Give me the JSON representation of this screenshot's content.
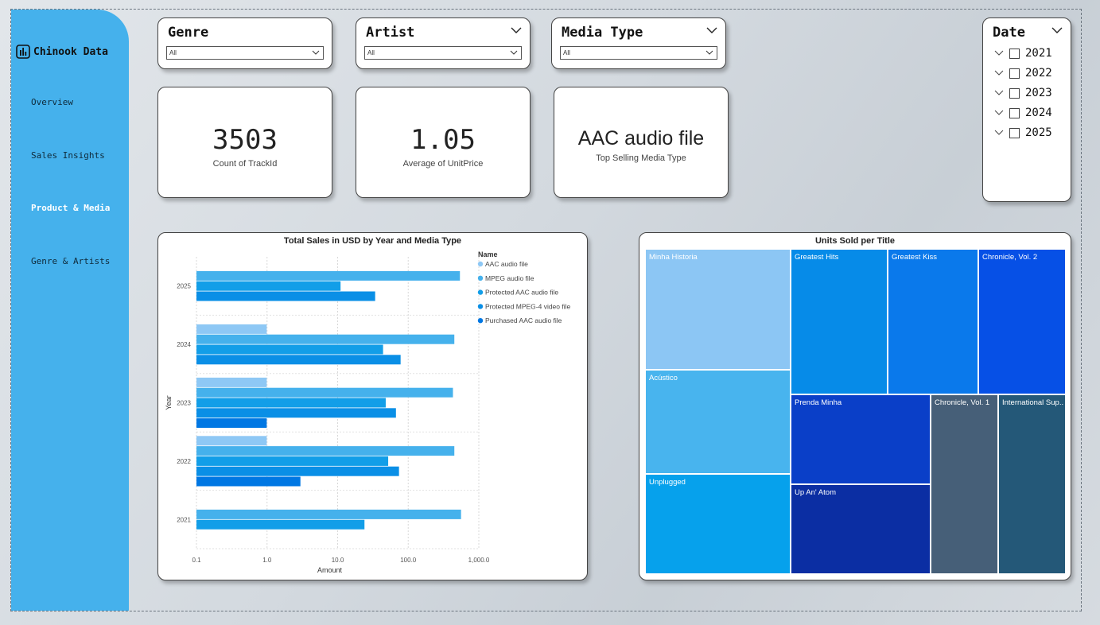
{
  "app": {
    "brand": "Chinook Data"
  },
  "nav": [
    {
      "label": "Overview",
      "active": false
    },
    {
      "label": "Sales Insights",
      "active": false
    },
    {
      "label": "Product & Media",
      "active": true
    },
    {
      "label": "Genre & Artists",
      "active": false
    }
  ],
  "slicers": {
    "genre": {
      "title": "Genre",
      "value": "All"
    },
    "artist": {
      "title": "Artist",
      "value": "All"
    },
    "media_type": {
      "title": "Media Type",
      "value": "All"
    },
    "date": {
      "title": "Date",
      "years": [
        "2021",
        "2022",
        "2023",
        "2024",
        "2025"
      ]
    }
  },
  "kpis": {
    "tracks": {
      "value": "3503",
      "label": "Count of TrackId"
    },
    "price": {
      "value": "1.05",
      "label": "Average of UnitPrice"
    },
    "media": {
      "value": "AAC audio file",
      "label": "Top Selling Media Type"
    }
  },
  "chart_data": [
    {
      "type": "bar",
      "orientation": "horizontal",
      "title": "Total Sales in USD by Year and Media Type",
      "xlabel": "Amount",
      "ylabel": "Year",
      "xscale": "log",
      "xlim": [
        0.1,
        1000
      ],
      "xticks": [
        "0.1",
        "1.0",
        "10.0",
        "100.0",
        "1,000.0"
      ],
      "categories": [
        "2025",
        "2024",
        "2023",
        "2022",
        "2021"
      ],
      "legend_title": "Name",
      "legend_position": "right",
      "grid": true,
      "series": [
        {
          "name": "AAC audio file",
          "color": "#8ec8f5",
          "values": [
            null,
            0.99,
            0.99,
            0.99,
            null
          ]
        },
        {
          "name": "MPEG audio file",
          "color": "#45b1ec",
          "values": [
            540,
            450,
            430,
            450,
            560
          ]
        },
        {
          "name": "Protected AAC audio file",
          "color": "#129ee8",
          "values": [
            11,
            44,
            48,
            52,
            24
          ]
        },
        {
          "name": "Protected MPEG-4 video file",
          "color": "#0a8fe6",
          "values": [
            34,
            78,
            67,
            74,
            null
          ]
        },
        {
          "name": "Purchased AAC audio file",
          "color": "#0077e3",
          "values": [
            null,
            null,
            0.99,
            2.97,
            null
          ]
        }
      ]
    },
    {
      "type": "treemap",
      "title": "Units Sold per Title",
      "items": [
        {
          "label": "Minha Historia",
          "color": "#8cc6f4"
        },
        {
          "label": "Acústico",
          "color": "#48b4ee"
        },
        {
          "label": "Unplugged",
          "color": "#06a1ec"
        },
        {
          "label": "Greatest Hits",
          "color": "#068be8"
        },
        {
          "label": "Greatest Kiss",
          "color": "#0a79eb"
        },
        {
          "label": "Chronicle, Vol. 2",
          "color": "#0650e6"
        },
        {
          "label": "Prenda Minha",
          "color": "#0a3fc8"
        },
        {
          "label": "Up An' Atom",
          "color": "#0b2ea3"
        },
        {
          "label": "Chronicle, Vol. 1",
          "color": "#465f78"
        },
        {
          "label": "International Sup...",
          "color": "#245878"
        }
      ]
    }
  ]
}
